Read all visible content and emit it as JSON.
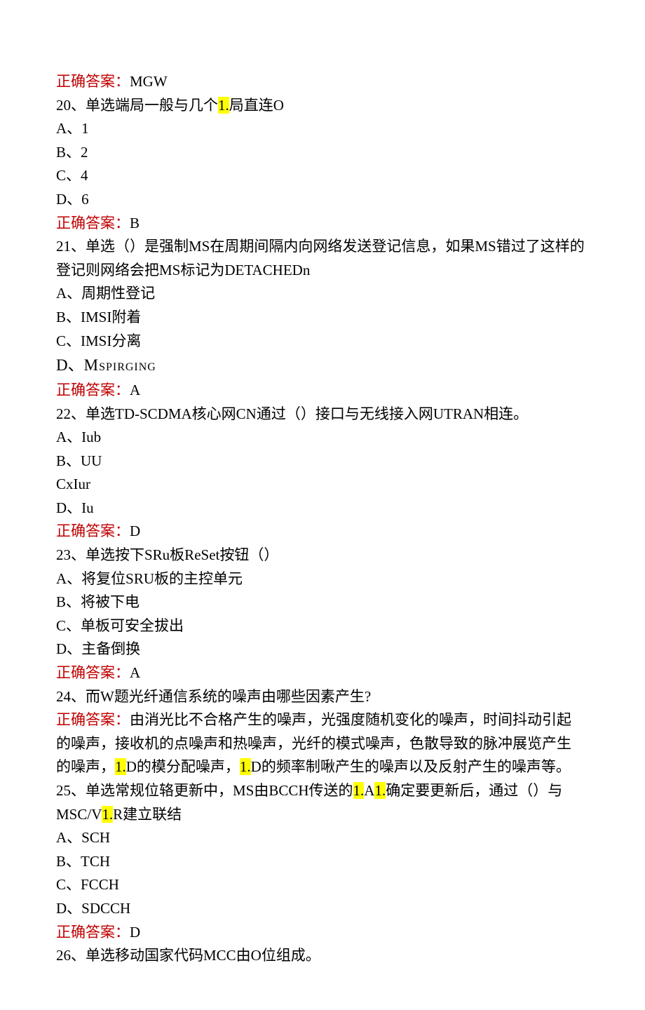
{
  "q19_answer": {
    "label": "正确答案：",
    "value": "MGW"
  },
  "q20": {
    "stem_pre": "20、单选端局一般与几个",
    "hl": "1.",
    "stem_post": "局直连O",
    "optA": "A、1",
    "optB": "B、2",
    "optC": "C、4",
    "optD": "D、6",
    "answer": {
      "label": "正确答案：",
      "value": "B"
    }
  },
  "q21": {
    "line1": "21、单选（）是强制MS在周期间隔内向网络发送登记信息，如果MS错过了这样的",
    "line2": "登记则网络会把MS标记为DETACHEDn",
    "optA": "A、周期性登记",
    "optB": "B、IMSI附着",
    "optC": "C、IMSI分离",
    "optD_pre": "D、",
    "optD_val": "Mspirging",
    "answer": {
      "label": "正确答案：",
      "value": "A"
    }
  },
  "q22": {
    "stem": "22、单选TD-SCDMA核心网CN通过（）接口与无线接入网UTRAN相连。",
    "optA": "A、Iub",
    "optB": "B、UU",
    "optC": "CxIur",
    "optD": "D、Iu",
    "answer": {
      "label": "正确答案：",
      "value": "D"
    }
  },
  "q23": {
    "stem": "23、单选按下SRu板ReSet按钮（）",
    "optA": "A、将复位SRU板的主控单元",
    "optB": "B、将被下电",
    "optC": "C、单板可安全拔出",
    "optD": "D、主备倒换",
    "answer": {
      "label": "正确答案：",
      "value": "A"
    }
  },
  "q24": {
    "stem": "24、而W题光纤通信系统的噪声由哪些因素产生?",
    "ans_label": "正确答案：",
    "ans_l1": "由消光比不合格产生的噪声，光强度随机变化的噪声，时间抖动引起",
    "ans_l2": "的噪声，接收机的点噪声和热噪声，光纤的模式噪声，色散导致的脉冲展览产生",
    "ans_l3_a": "的噪声，",
    "hl1": "1.",
    "ans_l3_b": "D的模分配噪声，",
    "hl2": "1.",
    "ans_l3_c": "D的频率制啾产生的噪声以及反射产生的噪声等。"
  },
  "q25": {
    "stem_a": "25、单选常规位辂更新中，MS由BCCH传送的",
    "hl1": "1.",
    "stem_b": "A",
    "hl2": "1.",
    "stem_c": "确定要更新后，通过（）与",
    "line2_a": "MSC/V",
    "hl3": "1.",
    "line2_b": "R建立联结",
    "optA": "A、SCH",
    "optB": "B、TCH",
    "optC": "C、FCCH",
    "optD": "D、SDCCH",
    "answer": {
      "label": "正确答案：",
      "value": "D"
    }
  },
  "q26": {
    "stem": "26、单选移动国家代码MCC由O位组成。"
  }
}
